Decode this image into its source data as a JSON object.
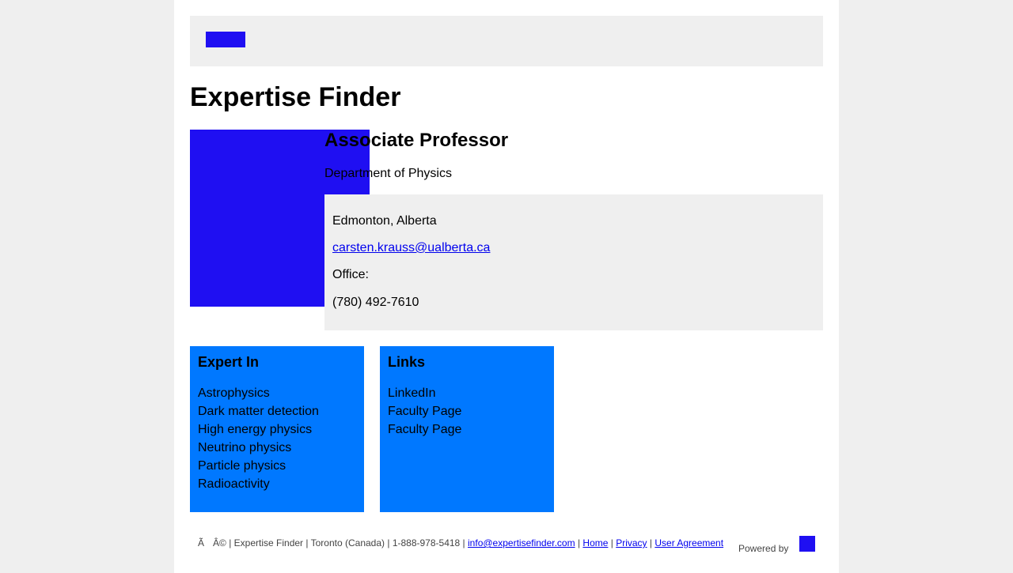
{
  "colors": {
    "page_background": "#efefef",
    "content_background": "#ffffff",
    "placeholder_image": "#1f0ff2",
    "card_background": "#0078ff",
    "contact_background": "#efefef",
    "link": "#0000ee"
  },
  "header": {
    "logo": "logo-image"
  },
  "page_title": "Expertise Finder",
  "profile": {
    "photo": "profile-photo",
    "title": "Associate Professor",
    "department": "Department of Physics",
    "contact": {
      "location": "Edmonton, Alberta",
      "email": "carsten.krauss@ualberta.ca",
      "office": "Office:",
      "phone": "(780) 492-7610"
    }
  },
  "expert_in": {
    "heading": "Expert In",
    "items": [
      "Astrophysics",
      "Dark matter detection",
      "High energy physics",
      "Neutrino physics",
      "Particle physics",
      "Radioactivity"
    ]
  },
  "links": {
    "heading": "Links",
    "items": [
      "LinkedIn",
      "Faculty Page",
      "Faculty Page"
    ]
  },
  "footer": {
    "char1": "Ã",
    "char2": "Â©",
    "company": "Expertise Finder",
    "location": "Toronto (Canada)",
    "phone": "1-888-978-5418",
    "email": "info@expertisefinder.com",
    "home": "Home",
    "privacy": "Privacy",
    "agreement": "User Agreement",
    "powered_by": "Powered by"
  }
}
